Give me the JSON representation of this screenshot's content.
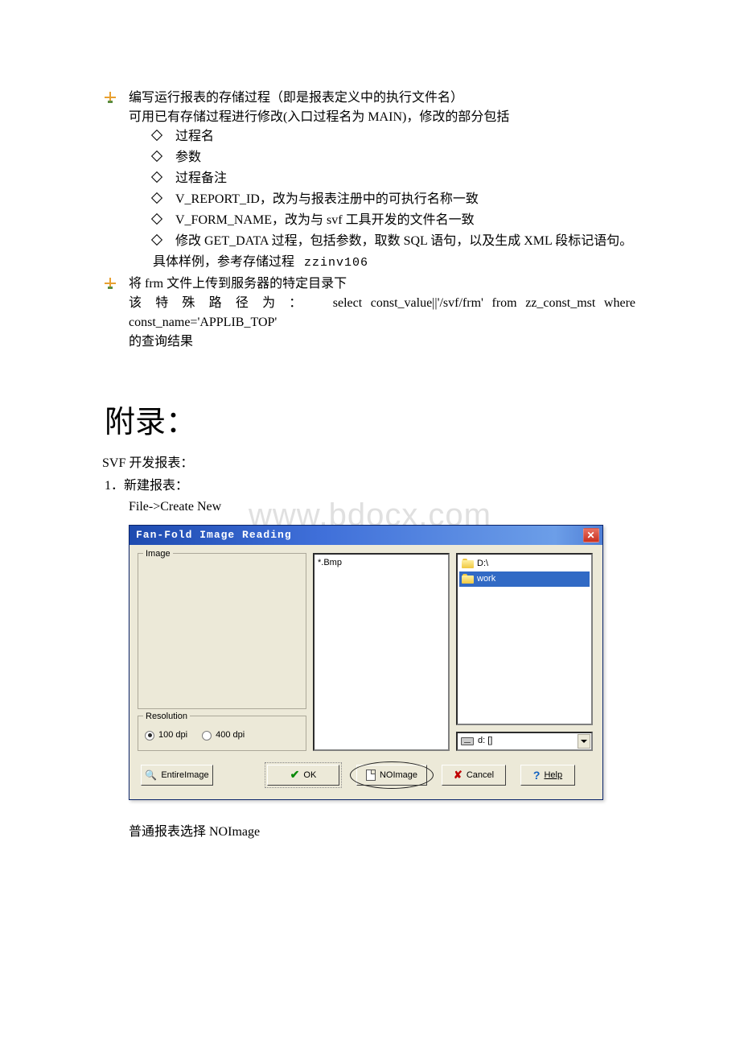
{
  "bullets": {
    "b1_line1": "编写运行报表的存储过程（即是报表定义中的执行文件名）",
    "b1_line2": "可用已有存储过程进行修改(入口过程名为 MAIN)，修改的部分包括",
    "b1_subs": {
      "s1": "过程名",
      "s2": "参数",
      "s3": "过程备注",
      "s4": "V_REPORT_ID，改为与报表注册中的可执行名称一致",
      "s5": "V_FORM_NAME，改为与 svf 工具开发的文件名一致",
      "s6": "修改 GET_DATA 过程，包括参数，取数 SQL 语句，以及生成 XML 段标记语句。"
    },
    "b1_note_prefix": "具体样例，参考存储过程",
    "b1_note_code": "zzinv106",
    "b2_line1": "将 frm 文件上传到服务器的特定目录下",
    "b2_line2_prefix": "该 特 殊 路 径 为 ：",
    "b2_line2_sql": "select   const_value||'/svf/frm'   from   zz_const_mst   where",
    "b2_line3": "const_name='APPLIB_TOP'",
    "b2_line4": "的查询结果"
  },
  "appendix_title": "附录：",
  "svf_label": "SVF 开发报表：",
  "step1_label": "1．新建报表：",
  "step1_body": "File->Create New",
  "dialog": {
    "title": "Fan-Fold  Image Reading",
    "image_label": "Image",
    "bmp_label": "*.Bmp",
    "tree": {
      "d_drive": "D:\\",
      "work": "work"
    },
    "drive_label": "d:  []",
    "resolution_label": "Resolution",
    "res_100": "100 dpi",
    "res_400": "400 dpi",
    "buttons": {
      "entire": "EntireImage",
      "ok": "OK",
      "noimage": "NOImage",
      "cancel": "Cancel",
      "help": "Help"
    }
  },
  "after_dialog": "普通报表选择 NOImage",
  "watermark": "www.bdocx.com"
}
